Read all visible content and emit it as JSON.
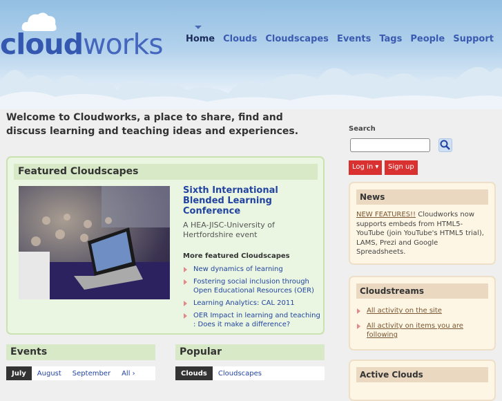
{
  "logo": {
    "bold": "cloud",
    "light": "works"
  },
  "nav": [
    "Home",
    "Clouds",
    "Cloudscapes",
    "Events",
    "Tags",
    "People",
    "Support"
  ],
  "welcome": "Welcome to Cloudworks, a place to share, find and discuss learning and teaching ideas and experiences.",
  "featured": {
    "heading": "Featured Cloudscapes",
    "title": "Sixth International Blended Learning Conference",
    "subtitle": "A HEA-JISC-University of Hertfordshire event",
    "more_heading": "More featured Cloudscapes",
    "more": [
      "New dynamics of learning",
      "Fostering social inclusion through Open Educational Resources (OER)",
      "Learning Analytics: CAL 2011",
      "OER Impact in learning and teaching : Does it make a difference?"
    ]
  },
  "events": {
    "heading": "Events",
    "tabs": [
      "July",
      "August",
      "September",
      "All ›"
    ]
  },
  "popular": {
    "heading": "Popular",
    "tabs": [
      "Clouds",
      "Cloudscapes"
    ]
  },
  "search": {
    "label": "Search",
    "value": ""
  },
  "auth": {
    "login": "Log in ▾",
    "signup": "Sign up"
  },
  "news": {
    "heading": "News",
    "link": "NEW FEATURES!!",
    "text": " Cloudworks now supports embeds from HTML5-YouTube (join YouTube's HTML5 trial), LAMS, Prezi and Google Spreadsheets."
  },
  "cloudstreams": {
    "heading": "Cloudstreams",
    "items": [
      "All activity on the site",
      "All activity on items you are following"
    ]
  },
  "active": {
    "heading": "Active Clouds"
  }
}
